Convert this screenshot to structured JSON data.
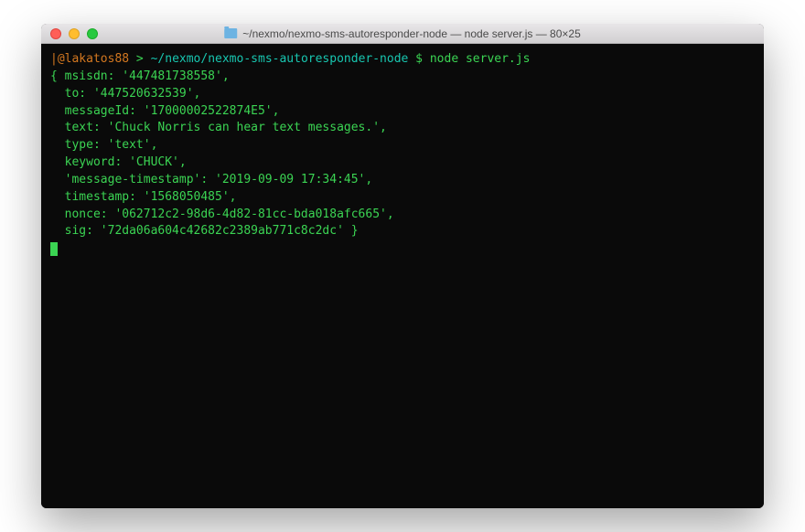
{
  "window": {
    "title": "~/nexmo/nexmo-sms-autoresponder-node — node server.js — 80×25"
  },
  "prompt": {
    "bracket": "|",
    "user": "@lakatos88",
    "sep": " > ",
    "cwd": "~/nexmo/nexmo-sms-autoresponder-node",
    "dollar": " $ ",
    "command": "node server.js"
  },
  "output": {
    "l1": "{ msisdn: '447481738558',",
    "l2": "  to: '447520632539',",
    "l3": "  messageId: '17000002522874E5',",
    "l4": "  text: 'Chuck Norris can hear text messages.',",
    "l5": "  type: 'text',",
    "l6": "  keyword: 'CHUCK',",
    "l7": "  'message-timestamp': '2019-09-09 17:34:45',",
    "l8": "  timestamp: '1568050485',",
    "l9": "  nonce: '062712c2-98d6-4d82-81cc-bda018afc665',",
    "l10": "  sig: '72da06a604c42682c2389ab771c8c2dc' }"
  }
}
